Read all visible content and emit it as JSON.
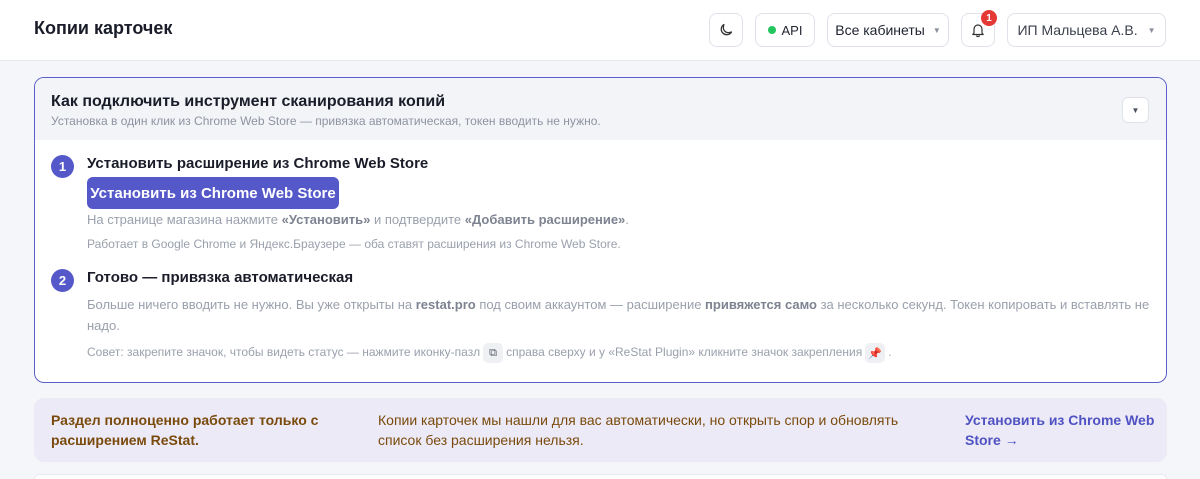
{
  "header": {
    "title": "Копии карточек",
    "api_label": "API",
    "cabinets_label": "Все кабинеты",
    "notifications_count": "1",
    "user_label": "ИП Мальцева А.В."
  },
  "card": {
    "title": "Как подключить инструмент сканирования копий",
    "subtitle": "Установка в один клик из Chrome Web Store — привязка автоматическая, токен вводить не нужно.",
    "step1": {
      "number": "1",
      "title": "Установить расширение из Chrome Web Store",
      "button": "Установить из Chrome Web Store",
      "hint_a": "На странице магазина нажмите ",
      "hint_b": "«Установить»",
      "hint_c": " и подтвердите ",
      "hint_d": "«Добавить расширение»",
      "hint_e": ".",
      "note": "Работает в Google Chrome и Яндекс.Браузере — оба ставят расширения из Chrome Web Store."
    },
    "step2": {
      "number": "2",
      "title": "Готово — привязка автоматическая",
      "text_a": "Больше ничего вводить не нужно. Вы уже открыты на ",
      "text_b": "restat.pro",
      "text_c": " под своим аккаунтом — расширение ",
      "text_d": "привяжется само",
      "text_e": " за несколько секунд. Токен копировать и вставлять не надо.",
      "tip_a": "Совет: закрепите значок, чтобы видеть статус — нажмите иконку-пазл",
      "tip_b": "справа сверху и у «ReStat Plugin» кликните значок закрепления",
      "tip_c": "."
    }
  },
  "notice": {
    "left": "Раздел полноценно работает только с расширением ReStat.",
    "middle": "Копии карточек мы нашли для вас автоматически, но открыть спор и обновлять список без расширения нельзя.",
    "link": "Установить из Chrome Web Store →"
  }
}
